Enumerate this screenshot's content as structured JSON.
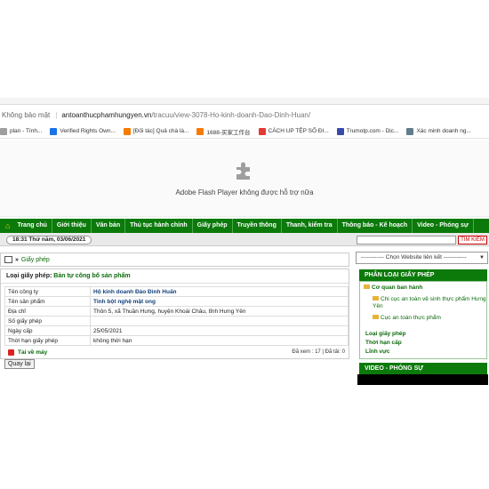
{
  "browser": {
    "insecure_label": "Không bảo mật",
    "separator": "|",
    "url_host": "antoanthucphamhungyen.vn",
    "url_path": "/tracuu/view-3078-Ho-kinh-doanh-Dao-Dinh-Huan/",
    "bookmarks": [
      {
        "label": "plan - Tính...",
        "color": "#9e9e9e"
      },
      {
        "label": "Verified Rights Own...",
        "color": "#1a73e8"
      },
      {
        "label": "[Đối tác] Quả chà là...",
        "color": "#f57c00"
      },
      {
        "label": "1688-买家工作台",
        "color": "#f57c00"
      },
      {
        "label": "CÁCH UP TỆP SỐ ĐI...",
        "color": "#e53935"
      },
      {
        "label": "Trumotp.com - Dịc...",
        "color": "#3949ab"
      },
      {
        "label": "Xác minh doanh ng...",
        "color": "#607d8b"
      }
    ]
  },
  "flash": {
    "message": "Adobe Flash Player không được hỗ trợ nữa"
  },
  "nav": {
    "items": [
      "Trang chủ",
      "Giới thiệu",
      "Văn bản",
      "Thủ tục hành chính",
      "Giấy phép",
      "Truyền thông",
      "Thanh, kiểm tra",
      "Thông báo - Kế hoạch",
      "Video - Phóng sự"
    ]
  },
  "datebar": {
    "date": "18:31 Thứ năm, 03/06/2021",
    "search_button": "TÌM KIẾM"
  },
  "breadcrumb": {
    "arrow": "»",
    "current": "Giấy phép"
  },
  "license": {
    "type_label": "Loại giấy phép:",
    "type_value": "Bản tự công bố sản phẩm",
    "rows": [
      {
        "key": "Tên công ty",
        "value": "Hộ kinh doanh Đào Đình Huấn"
      },
      {
        "key": "Tên sản phẩm",
        "value": "Tinh bột nghệ mật ong"
      },
      {
        "key": "Địa chỉ",
        "value": "Thôn 5, xã Thuần Hưng, huyện Khoái Châu, tỉnh Hưng Yên"
      },
      {
        "key": "Số giấy phép",
        "value": ""
      },
      {
        "key": "Ngày cấp",
        "value": "25/05/2021"
      },
      {
        "key": "Thời hạn giấy phép",
        "value": "không thời hạn"
      }
    ],
    "download_label": "Tải về máy",
    "stats": "Đã xem : 17 | Đã tải: 0",
    "back_button": "Quay lại"
  },
  "sidebar": {
    "site_select": "------------ Chọn Website liên kết ------------",
    "license_head": "PHÂN LOẠI GIẤY PHÉP",
    "group1": "Cơ quan ban hành",
    "sub1": "Chi cục an toàn vệ sinh thực phẩm Hưng Yên",
    "sub2": "Cục an toàn thực phẩm",
    "group2": "Loại giấy phép",
    "group3": "Thời hạn cấp",
    "group4": "Lĩnh vực",
    "video_head": "VIDEO - PHÓNG SỰ"
  },
  "colors": {
    "nav_green": "#0b7a0b",
    "link_green": "#0b6a0b",
    "search_red": "#cc0000"
  }
}
